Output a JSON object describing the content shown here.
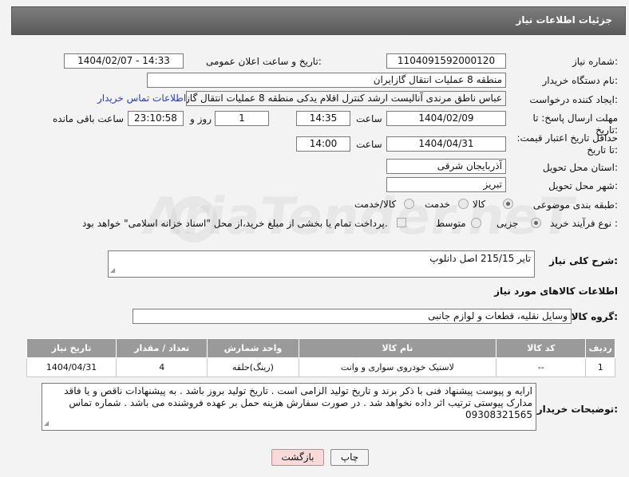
{
  "header": {
    "title": "جزئیات اطلاعات نیاز"
  },
  "labels": {
    "need_number": "شماره نیاز:",
    "announce_datetime": "تاریخ و ساعت اعلان عمومی:",
    "buyer_org": "نام دستگاه خریدار:",
    "requester": "ایجاد کننده درخواست:",
    "reply_deadline": "مهلت ارسال پاسخ: تا تاریخ:",
    "time1": "ساعت",
    "days_and": "روز و",
    "hours_remaining": "ساعت باقی مانده",
    "price_validity": "حداقل تاریخ اعتبار قیمت: تا تاریخ:",
    "time2": "ساعت",
    "delivery_province": "استان محل تحویل:",
    "delivery_city": "شهر محل تحویل:",
    "subject_category": "طبقه بندی موضوعی:",
    "purchase_process": "نوع فرآیند خرید :",
    "general_description": "شرح کلی نیاز:",
    "goods_info": "اطلاعات کالاهای مورد نیاز",
    "goods_group": "گروه کالا:",
    "buyer_notes": "توضیحات خریدار:"
  },
  "values": {
    "need_number": "1104091592000120",
    "announce_datetime": "1404/02/07 - 14:33",
    "buyer_org": "منطقه 8 عملیات انتقال گازایران",
    "requester": "عباس ناطق مرندی آنالیست ارشد کنترل اقلام یدکی منطقه 8 عملیات انتقال گاز",
    "buyer_contact_link": "اطلاعات تماس خریدار",
    "reply_date": "1404/02/09",
    "reply_time": "14:35",
    "days": "1",
    "remaining": "23:10:58",
    "validity_date": "1404/04/31",
    "validity_time": "14:00",
    "province": "آذربایجان شرقی",
    "city": "تبریز",
    "general_description": "تایر 215/15 اصل دانلوپ",
    "goods_group": "وسایل نقلیه، قطعات و لوازم جانبی",
    "buyer_notes": "ارایه و پیوست پیشنهاد فنی با ذکر برند و تاریخ تولید الزامی است . تاریخ تولید بروز باشد . به پیشنهادات ناقص و یا فاقد مدارک پیوستی ترتیب اثر داده نخواهد شد . در صورت سفارش هزینه حمل بر عهده فروشنده می باشد . شماره تماس 09308321565"
  },
  "category_options": [
    "کالا",
    "خدمت",
    "کالا/خدمت"
  ],
  "category_selected": "کالا",
  "process_options": [
    "جزیی",
    "متوسط"
  ],
  "process_selected": "جزیی",
  "payment_note": "پرداخت تمام یا بخشی از مبلغ خرید،از محل \"اسناد خزانه اسلامی\" خواهد بود.",
  "table": {
    "headers": [
      "ردیف",
      "کد کالا",
      "نام کالا",
      "واحد شمارش",
      "تعداد / مقدار",
      "تاریخ نیاز"
    ],
    "rows": [
      [
        "1",
        "--",
        "لاستیک خودروی سواری و وانت",
        "(رینگ)حلقه",
        "4",
        "1404/04/31"
      ]
    ]
  },
  "buttons": {
    "print": "چاپ",
    "back": "بازگشت"
  },
  "watermark": "AriaTender.neT"
}
